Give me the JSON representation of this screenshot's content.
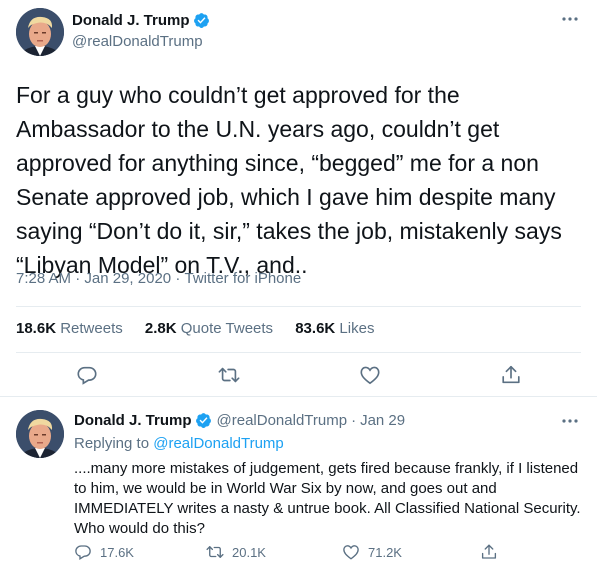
{
  "colors": {
    "accent": "#1da1f2",
    "text": "#0f1419",
    "muted": "#5b7083",
    "border": "#e6ecf0"
  },
  "main_tweet": {
    "author": {
      "name": "Donald J. Trump",
      "handle": "@realDonaldTrump",
      "verified_icon": "verified-badge-icon"
    },
    "text": "For a guy who couldn’t get approved for the Ambassador to the U.N. years ago, couldn’t get approved for anything since, “begged” me for a non Senate approved job, which I gave him despite many saying “Don’t do it, sir,” takes the job, mistakenly says “Libyan Model” on T.V., and..",
    "time": "7:28 AM",
    "date": "Jan 29, 2020",
    "source": "Twitter for iPhone",
    "separator": "·",
    "stats": {
      "retweets_count": "18.6K",
      "retweets_label": "Retweets",
      "quotes_count": "2.8K",
      "quotes_label": "Quote Tweets",
      "likes_count": "83.6K",
      "likes_label": "Likes"
    },
    "actions": [
      "reply-icon",
      "retweet-icon",
      "like-icon",
      "share-icon"
    ]
  },
  "reply_tweet": {
    "author": {
      "name": "Donald J. Trump",
      "handle": "@realDonaldTrump"
    },
    "separator": "·",
    "date": "Jan 29",
    "replying_prefix": "Replying to",
    "replying_handle": "@realDonaldTrump",
    "text": "....many more mistakes of judgement, gets fired because frankly, if I listened to him, we would be in World War Six by now, and goes out and IMMEDIATELY writes a nasty & untrue book. All Classified National Security. Who would do this?",
    "counts": {
      "replies": "17.6K",
      "retweets": "20.1K",
      "likes": "71.2K"
    }
  }
}
